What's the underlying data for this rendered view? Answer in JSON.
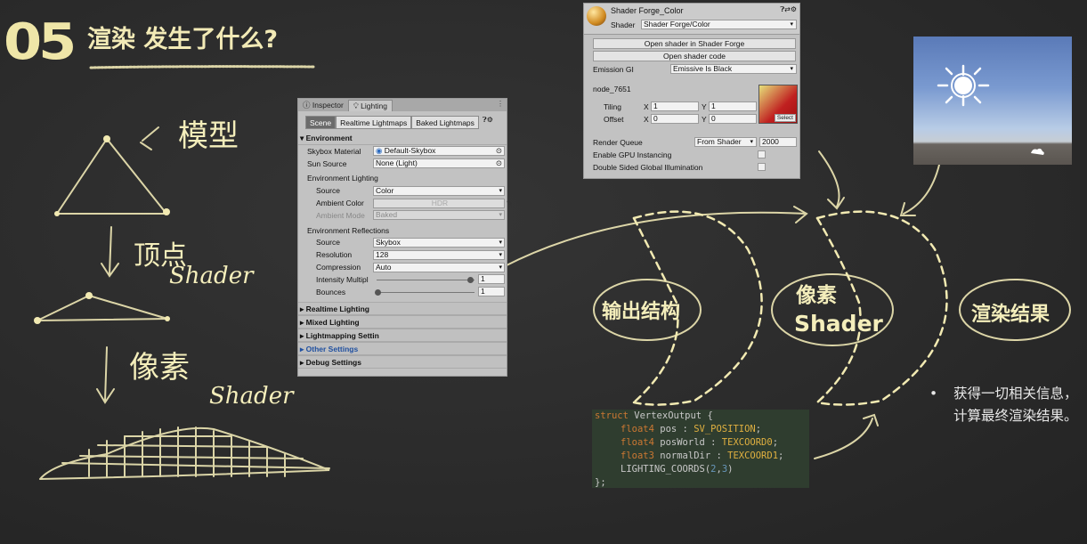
{
  "slide": {
    "number": "05",
    "title": "渲染 发生了什么?"
  },
  "sketch": {
    "model_label": "模型",
    "vertex_label_cn": "顶点",
    "vertex_label_en": "Shader",
    "pixel_label_cn": "像素",
    "pixel_label_en": "Shader"
  },
  "inspector": {
    "tabs": [
      "Inspector",
      "Lighting"
    ],
    "subtabs": [
      "Scene",
      "Realtime Lightmaps",
      "Baked Lightmaps"
    ],
    "environment": "Environment",
    "skybox_material_label": "Skybox Material",
    "skybox_material_value": "Default-Skybox",
    "sun_source_label": "Sun Source",
    "sun_source_value": "None (Light)",
    "env_lighting": "Environment Lighting",
    "source_label": "Source",
    "source_value": "Color",
    "ambient_color_label": "Ambient Color",
    "ambient_color_value": "HDR",
    "ambient_mode_label": "Ambient Mode",
    "ambient_mode_value": "Baked",
    "env_reflections": "Environment Reflections",
    "refl_source_label": "Source",
    "refl_source_value": "Skybox",
    "resolution_label": "Resolution",
    "resolution_value": "128",
    "compression_label": "Compression",
    "compression_value": "Auto",
    "intensity_label": "Intensity Multipl",
    "intensity_value": "1",
    "intensity_level": 1.0,
    "bounces_label": "Bounces",
    "bounces_value": "1",
    "bounces_level": 0.0,
    "sections": [
      "Realtime Lighting",
      "Mixed Lighting",
      "Lightmapping Settin",
      "Other Settings",
      "Debug Settings"
    ]
  },
  "shader_panel": {
    "title": "Shader Forge_Color",
    "shader_label": "Shader",
    "shader_value": "Shader Forge/Color",
    "btn_open_forge": "Open shader in Shader Forge",
    "btn_open_code": "Open shader code",
    "emission_label": "Emission GI",
    "emission_value": "Emissive Is Black",
    "node_label": "node_7651",
    "tiling_label": "Tiling",
    "offset_label": "Offset",
    "x_label": "X",
    "y_label": "Y",
    "tiling_x": "1",
    "tiling_y": "1",
    "offset_x": "0",
    "offset_y": "0",
    "select_label": "Select",
    "render_queue_label": "Render Queue",
    "render_queue_mode": "From Shader",
    "render_queue_value": "2000",
    "gpu_instancing_label": "Enable GPU Instancing",
    "double_sided_label": "Double Sided Global Illumination"
  },
  "flow": {
    "output_struct": "输出结构",
    "pixel_shader_cn": "像素",
    "pixel_shader_en": "Shader",
    "render_result": "渲染结果"
  },
  "bullet": {
    "symbol": "•",
    "text": "获得一切相关信息，计算最终渲染结果。"
  },
  "code": {
    "line1_kw": "struct",
    "line1_rest": " VertexOutput {",
    "line2_type": "float4",
    "line2_name": " pos : ",
    "line2_sem": "SV_POSITION",
    "line3_type": "float4",
    "line3_name": " posWorld : ",
    "line3_sem": "TEXCOORD0",
    "line4_type": "float3",
    "line4_name": " normalDir : ",
    "line4_sem": "TEXCOORD1",
    "line5_pre": "LIGHTING_COORDS(",
    "line5_a": "2",
    "line5_comma": ",",
    "line5_b": "3",
    "line5_post": ")",
    "line6": "};"
  }
}
